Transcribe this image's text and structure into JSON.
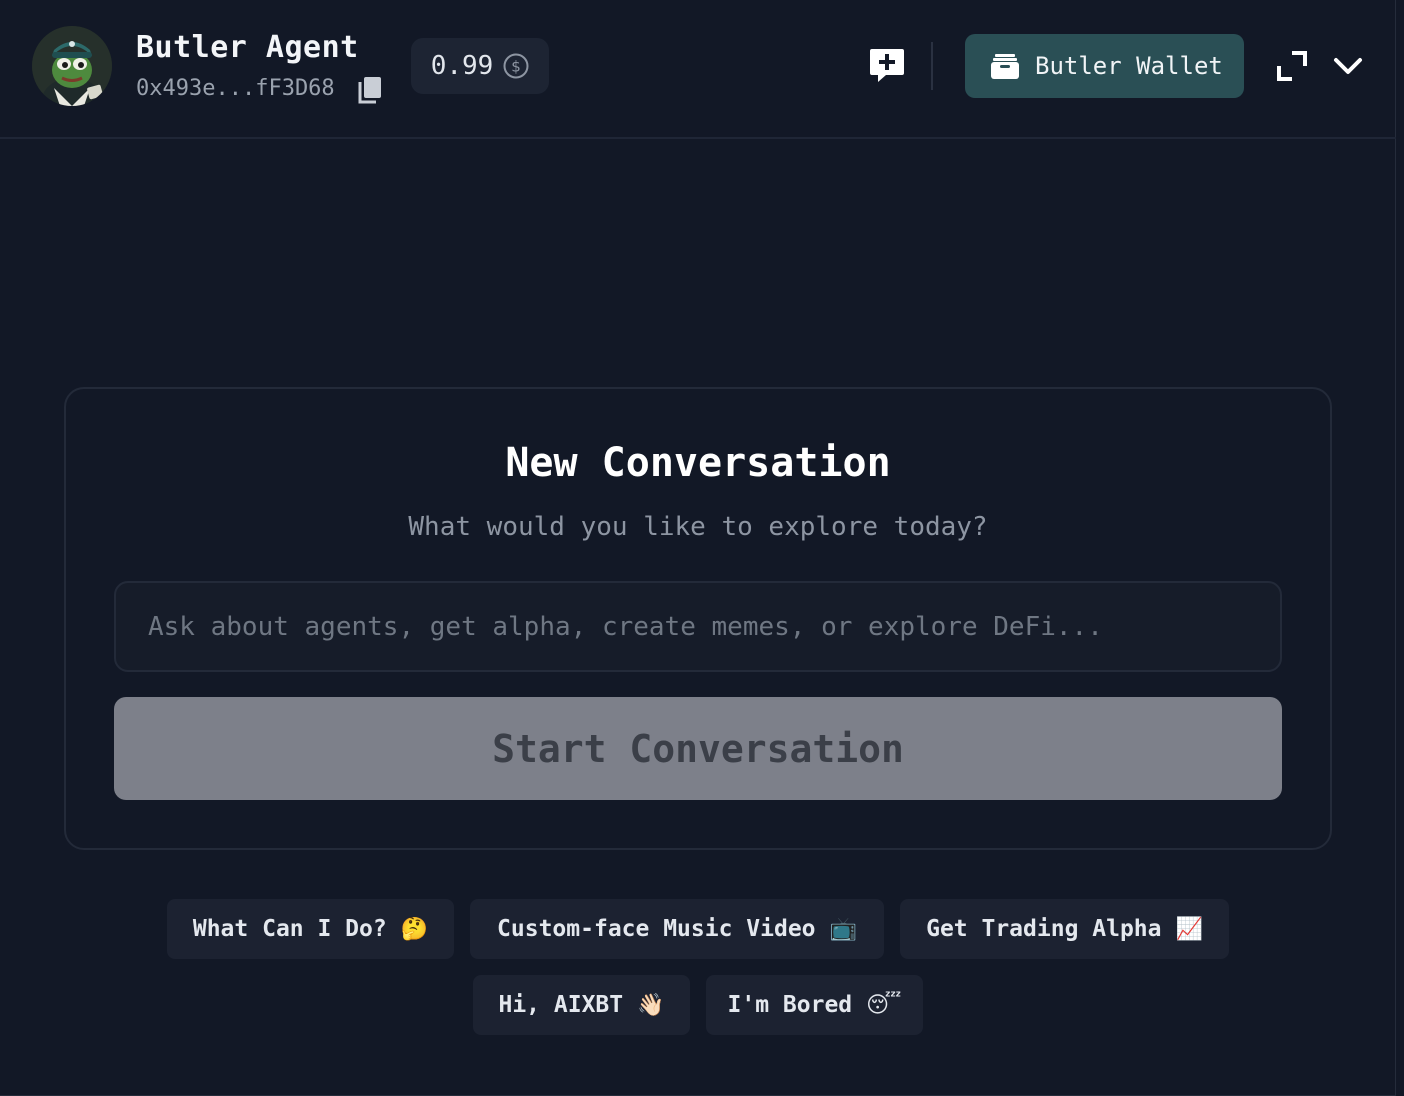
{
  "header": {
    "agent_name": "Butler Agent",
    "agent_address": "0x493e...fF3D68",
    "balance": "0.99",
    "wallet_button_label": "Butler Wallet"
  },
  "main": {
    "title": "New Conversation",
    "subtitle": "What would you like to explore today?",
    "input_placeholder": "Ask about agents, get alpha, create memes, or explore DeFi...",
    "start_button_label": "Start Conversation"
  },
  "suggestions": [
    {
      "label": "What Can I Do?",
      "emoji": "🤔"
    },
    {
      "label": "Custom-face Music Video",
      "emoji": "📺"
    },
    {
      "label": "Get Trading Alpha",
      "emoji": "📈"
    },
    {
      "label": "Hi, AIXBT",
      "emoji": "👋🏻"
    },
    {
      "label": "I'm Bored",
      "emoji": "😴"
    }
  ],
  "colors": {
    "background": "#121826",
    "wallet_button": "#2a4f55",
    "start_button_disabled": "#7d808a",
    "suggestion_bg": "#1c2231"
  },
  "icons": [
    "copy-icon",
    "coin-dollar-icon",
    "new-chat-icon",
    "wallet-icon",
    "expand-icon",
    "chevron-down-icon"
  ]
}
